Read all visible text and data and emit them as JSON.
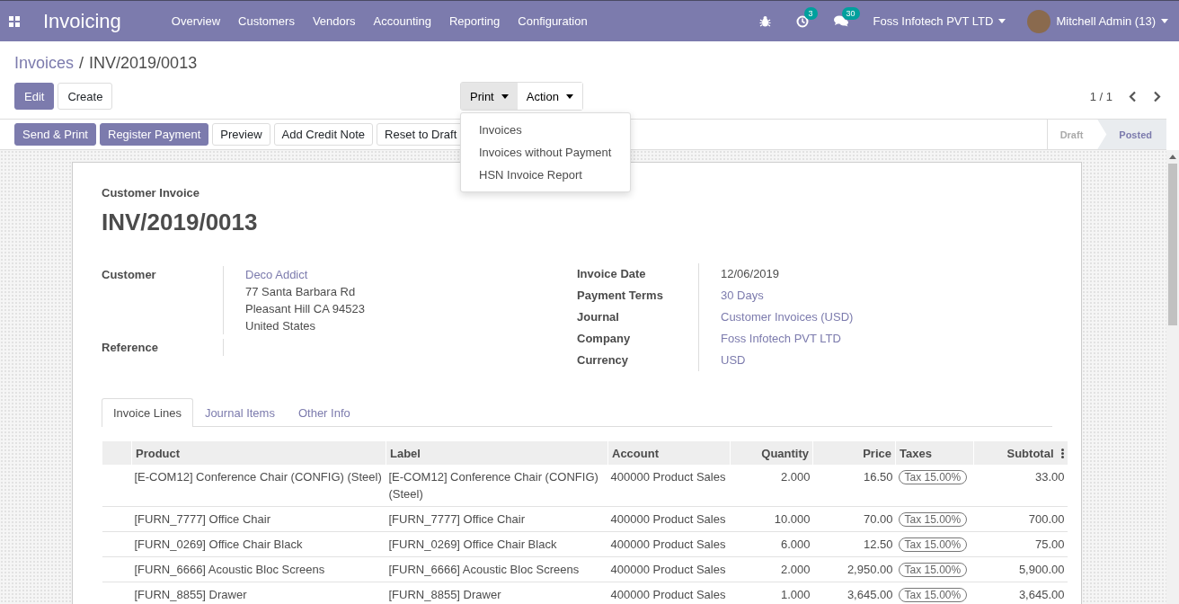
{
  "navbar": {
    "app_title": "Invoicing",
    "menu": [
      "Overview",
      "Customers",
      "Vendors",
      "Accounting",
      "Reporting",
      "Configuration"
    ],
    "activity_count": "3",
    "message_count": "30",
    "company": "Foss Infotech PVT LTD",
    "user": "Mitchell Admin (13)"
  },
  "breadcrumb": {
    "parent": "Invoices",
    "separator": "/",
    "current": "INV/2019/0013"
  },
  "buttons": [
    {
      "label": "Edit",
      "kind": "primary"
    },
    {
      "label": "Create",
      "kind": "secondary"
    }
  ],
  "print_menu": {
    "buttons": [
      {
        "label": "Print",
        "expanded": true
      },
      {
        "label": "Action",
        "expanded": false
      }
    ],
    "items": [
      "Invoices",
      "Invoices without Payment",
      "HSN Invoice Report"
    ]
  },
  "pager": "1 / 1",
  "status_buttons": [
    {
      "label": "Send & Print",
      "kind": "primary"
    },
    {
      "label": "Register Payment",
      "kind": "primary"
    },
    {
      "label": "Preview",
      "kind": "secondary"
    },
    {
      "label": "Add Credit Note",
      "kind": "secondary"
    },
    {
      "label": "Reset to Draft",
      "kind": "secondary"
    }
  ],
  "stages": [
    {
      "label": "Draft",
      "selected": false
    },
    {
      "label": "Posted",
      "selected": true
    }
  ],
  "invoice": {
    "type_label": "Customer Invoice",
    "number": "INV/2019/0013",
    "left_fields": [
      {
        "label": "Customer",
        "values": [
          {
            "text": "Deco Addict",
            "kind": "link"
          },
          {
            "text": "77 Santa Barbara Rd",
            "kind": "text"
          },
          {
            "text": "Pleasant Hill CA 94523",
            "kind": "text"
          },
          {
            "text": "United States",
            "kind": "text"
          }
        ]
      },
      {
        "label": "Reference"
      }
    ],
    "right_fields": [
      {
        "label": "Invoice Date",
        "value": "12/06/2019",
        "kind": "text"
      },
      {
        "label": "Payment Terms",
        "value": "30 Days",
        "kind": "link"
      },
      {
        "label": "Journal",
        "value": "Customer Invoices (USD)",
        "kind": "link"
      },
      {
        "label": "Company",
        "value": "Foss Infotech PVT LTD",
        "kind": "link"
      },
      {
        "label": "Currency",
        "value": "USD",
        "kind": "link"
      }
    ]
  },
  "tabs": [
    {
      "label": "Invoice Lines",
      "selected": true
    },
    {
      "label": "Journal Items",
      "selected": false
    },
    {
      "label": "Other Info",
      "selected": false
    }
  ],
  "table": {
    "columns": [
      "Product",
      "Label",
      "Account",
      "Quantity",
      "Price",
      "Taxes",
      "Subtotal"
    ],
    "rows": [
      {
        "cells": [
          "[E-COM12] Conference Chair (CONFIG) (Steel)",
          "[E-COM12] Conference Chair (CONFIG) (Steel)",
          "400000 Product Sales",
          "2.000",
          "16.50",
          "Tax 15.00%",
          "33.00"
        ]
      },
      {
        "cells": [
          "[FURN_7777] Office Chair",
          "[FURN_7777] Office Chair",
          "400000 Product Sales",
          "10.000",
          "70.00",
          "Tax 15.00%",
          "700.00"
        ]
      },
      {
        "cells": [
          "[FURN_0269] Office Chair Black",
          "[FURN_0269] Office Chair Black",
          "400000 Product Sales",
          "6.000",
          "12.50",
          "Tax 15.00%",
          "75.00"
        ]
      },
      {
        "cells": [
          "[FURN_6666] Acoustic Bloc Screens",
          "[FURN_6666] Acoustic Bloc Screens",
          "400000 Product Sales",
          "2.000",
          "2,950.00",
          "Tax 15.00%",
          "5,900.00"
        ]
      },
      {
        "cells": [
          "[FURN_8855] Drawer",
          "[FURN_8855] Drawer",
          "400000 Product Sales",
          "1.000",
          "3,645.00",
          "Tax 15.00%",
          "3,645.00"
        ]
      }
    ]
  }
}
